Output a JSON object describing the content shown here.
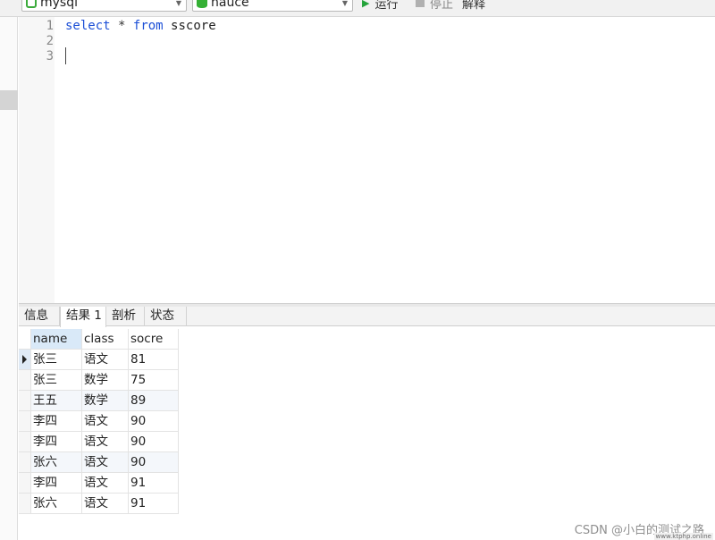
{
  "toolbar": {
    "connection": "mysql",
    "database": "nauce",
    "run_label": "运行",
    "stop_label": "停止",
    "explain_label": "解释"
  },
  "editor": {
    "lines": [
      {
        "number": "1",
        "tokens": {
          "k1": "select",
          "op": "*",
          "k2": "from",
          "table": "sscore"
        }
      },
      {
        "number": "2",
        "text": ""
      },
      {
        "number": "3",
        "text": ""
      }
    ]
  },
  "result_tabs": [
    {
      "label": "信息"
    },
    {
      "label": "结果 1"
    },
    {
      "label": "剖析"
    },
    {
      "label": "状态"
    }
  ],
  "active_tab": "结果 1",
  "grid": {
    "columns": [
      "name",
      "class",
      "socre"
    ],
    "rows": [
      [
        "张三",
        "语文",
        "81"
      ],
      [
        "张三",
        "数学",
        "75"
      ],
      [
        "王五",
        "数学",
        "89"
      ],
      [
        "李四",
        "语文",
        "90"
      ],
      [
        "李四",
        "语文",
        "90"
      ],
      [
        "张六",
        "语文",
        "90"
      ],
      [
        "李四",
        "语文",
        "91"
      ],
      [
        "张六",
        "语文",
        "91"
      ]
    ],
    "current_row": 0
  },
  "watermark": {
    "text": "CSDN @小白的测试之路",
    "site": "www.ktphp.online"
  },
  "icons": {
    "connection": "mysql-connection-icon",
    "database": "database-icon",
    "run": "play-icon",
    "stop": "stop-icon",
    "explain": "explain-icon",
    "chevron": "chevron-down-icon"
  }
}
